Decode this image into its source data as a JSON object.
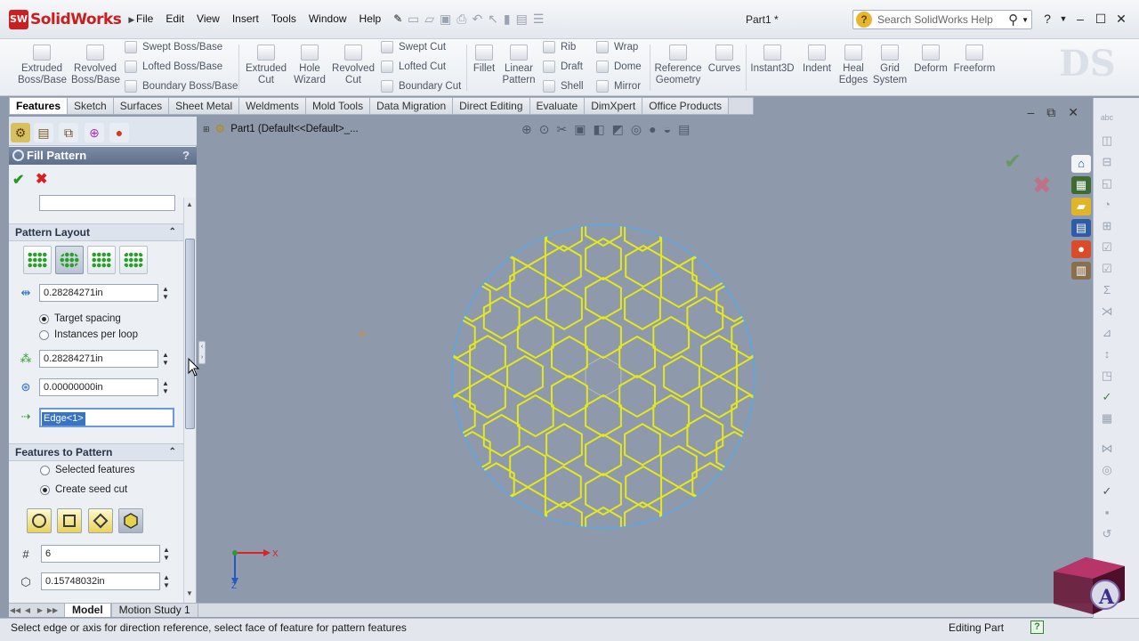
{
  "app": {
    "brand_short": "SW",
    "brand": "SolidWorks",
    "document_title": "Part1 *"
  },
  "menu": [
    "File",
    "Edit",
    "View",
    "Insert",
    "Tools",
    "Window",
    "Help"
  ],
  "search": {
    "placeholder": "Search SolidWorks Help"
  },
  "ribbon": {
    "extruded_boss": [
      "Extruded",
      "Boss/Base"
    ],
    "revolved_boss": [
      "Revolved",
      "Boss/Base"
    ],
    "swept_boss": "Swept Boss/Base",
    "lofted_boss": "Lofted Boss/Base",
    "boundary_boss": "Boundary Boss/Base",
    "extruded_cut": [
      "Extruded",
      "Cut"
    ],
    "hole_wizard": [
      "Hole",
      "Wizard"
    ],
    "revolved_cut": [
      "Revolved",
      "Cut"
    ],
    "swept_cut": "Swept Cut",
    "lofted_cut": "Lofted Cut",
    "boundary_cut": "Boundary Cut",
    "fillet": "Fillet",
    "linear_pattern": [
      "Linear",
      "Pattern"
    ],
    "rib": "Rib",
    "draft": "Draft",
    "shell": "Shell",
    "wrap": "Wrap",
    "dome": "Dome",
    "mirror": "Mirror",
    "reference_geometry": [
      "Reference",
      "Geometry"
    ],
    "curves": "Curves",
    "instant3d": "Instant3D",
    "indent": "Indent",
    "heal_edges": [
      "Heal",
      "Edges"
    ],
    "grid_system": [
      "Grid",
      "System"
    ],
    "deform": "Deform",
    "freeform": "Freeform"
  },
  "tabs": [
    "Features",
    "Sketch",
    "Surfaces",
    "Sheet Metal",
    "Weldments",
    "Mold Tools",
    "Data Migration",
    "Direct Editing",
    "Evaluate",
    "DimXpert",
    "Office Products"
  ],
  "property_manager": {
    "title": "Fill Pattern",
    "help": "?",
    "pattern_layout": {
      "label": "Pattern Layout",
      "spacing_value": "0.28284271in",
      "target_spacing": "Target spacing",
      "instances_per_loop": "Instances per loop",
      "loop_spacing_value": "0.28284271in",
      "angle_value": "0.00000000in",
      "direction_value": "Edge<1>"
    },
    "features_to_pattern": {
      "label": "Features to Pattern",
      "selected_features": "Selected features",
      "create_seed_cut": "Create seed cut",
      "number_of_sides": "6",
      "diameter_value": "0.15748032in"
    }
  },
  "graphics": {
    "tree_item": "Part1  (Default<<Default>_...",
    "triad_x": "X",
    "triad_z": "Z"
  },
  "bottom_tabs": [
    "Model",
    "Motion Study 1"
  ],
  "status": {
    "message": "Select edge or axis for direction reference, select face of feature for pattern features",
    "mode": "Editing Part"
  },
  "colors": {
    "pattern": "#e4e81c",
    "boundary": "#59a8e6",
    "background": "#8e99ab"
  }
}
